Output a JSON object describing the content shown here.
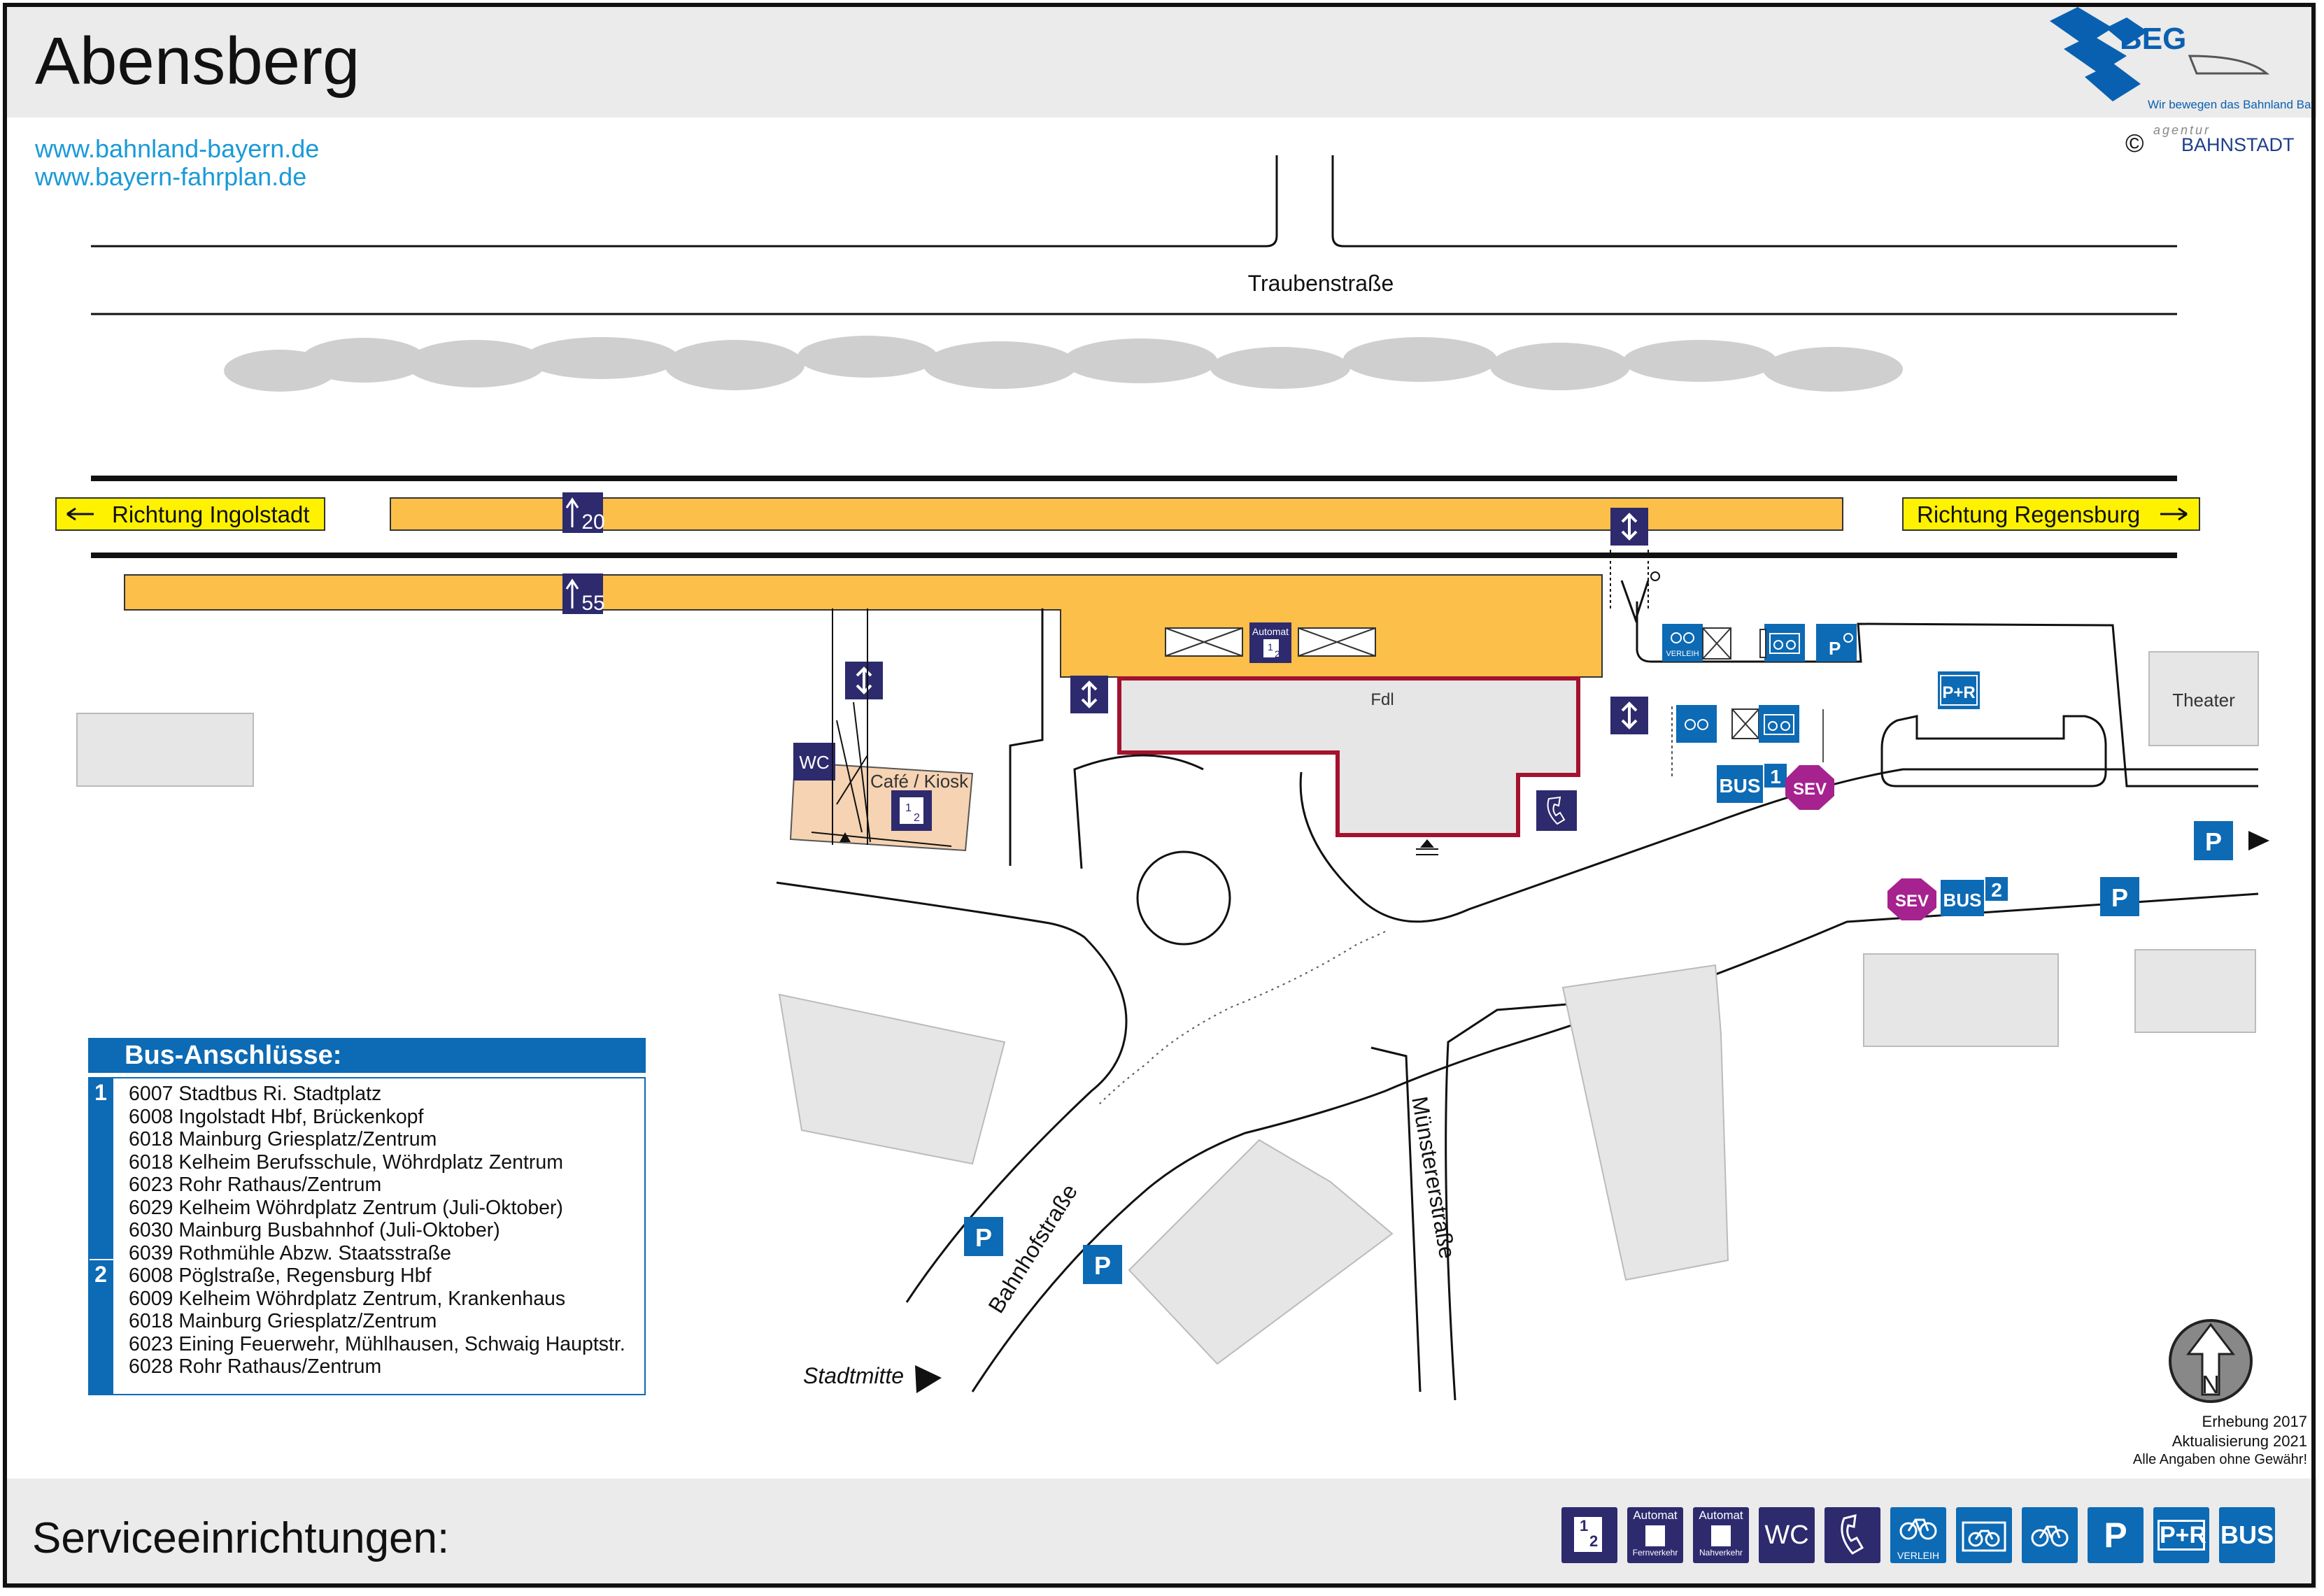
{
  "header": {
    "title": "Abensberg",
    "logo_text": "BEG",
    "logo_tagline": "Wir bewegen das Bahnland Bayern",
    "copyright_symbol": "©",
    "agency_small": "agentur",
    "agency_name": "BAHNSTADT"
  },
  "links": [
    "www.bahnland-bayern.de",
    "www.bayern-fahrplan.de"
  ],
  "streets": {
    "top": "Traubenstraße",
    "bahnhof": "Bahnhofstraße",
    "muenster": "Münstererstraße",
    "stadtmitte": "Stadtmitte"
  },
  "directions": {
    "west": "Richtung Ingolstadt",
    "east": "Richtung Regensburg"
  },
  "platforms": [
    {
      "number": "20"
    },
    {
      "number": "55"
    }
  ],
  "buildings": {
    "fdl": "Fdl",
    "cafe": "Café / Kiosk",
    "theater": "Theater"
  },
  "map_labels": {
    "wc": "WC",
    "automat": "Automat",
    "ticket_digits": [
      "1",
      "2"
    ],
    "verleih": "VERLEIH",
    "p": "P",
    "p_plus_r": "P+R",
    "bus": "BUS",
    "sev": "SEV",
    "bus_stop_1": "1",
    "bus_stop_2": "2",
    "north": "N"
  },
  "bus": {
    "heading": "Bus-Anschlüsse:",
    "groups": [
      {
        "stop": "1",
        "lines": [
          "6007 Stadtbus Ri. Stadtplatz",
          "6008 Ingolstadt Hbf, Brückenkopf",
          "6018 Mainburg Griesplatz/Zentrum",
          "6018 Kelheim Berufsschule, Wöhrdplatz Zentrum",
          "6023 Rohr Rathaus/Zentrum",
          "6029 Kelheim Wöhrdplatz Zentrum (Juli-Oktober)",
          "6030 Mainburg Busbahnhof (Juli-Oktober)",
          "6039 Rothmühle Abzw. Staatsstraße"
        ]
      },
      {
        "stop": "2",
        "lines": [
          "6008 Pöglstraße, Regensburg Hbf",
          "6009 Kelheim Wöhrdplatz Zentrum, Krankenhaus",
          "6018 Mainburg Griesplatz/Zentrum",
          "6023 Eining Feuerwehr, Mühlhausen, Schwaig Hauptstr.",
          "6028 Rohr Rathaus/Zentrum"
        ]
      }
    ]
  },
  "notes": {
    "survey": "Erhebung 2017",
    "update": "Aktualisierung 2021",
    "disclaimer": "Alle Angaben ohne Gewähr!"
  },
  "footer": {
    "title": "Serviceeinrichtungen:",
    "icons": [
      {
        "name": "ticket-counter-icon",
        "digits": [
          "1",
          "2"
        ]
      },
      {
        "name": "automat-fernverkehr-icon",
        "top": "Automat",
        "bottom": "Fernverkehr"
      },
      {
        "name": "automat-nahverkehr-icon",
        "top": "Automat",
        "bottom": "Nahverkehr"
      },
      {
        "name": "wc-icon",
        "label": "WC"
      },
      {
        "name": "phone-icon"
      },
      {
        "name": "bike-rental-icon",
        "bottom": "VERLEIH"
      },
      {
        "name": "bike-box-icon"
      },
      {
        "name": "bike-parking-icon"
      },
      {
        "name": "parking-icon",
        "label": "P"
      },
      {
        "name": "park-and-ride-icon",
        "label": "P+R"
      },
      {
        "name": "bus-icon",
        "label": "BUS"
      }
    ]
  },
  "colors": {
    "platform": "#fbbf4a",
    "direction_box": "#fff200",
    "service_dark": "#2d2a6e",
    "service_blue": "#0d6ab4",
    "sev": "#a6228f",
    "station_outline": "#a3122e",
    "building": "#e6e6e6",
    "cafe": "#f5d3b3",
    "link": "#1a9ad8"
  }
}
